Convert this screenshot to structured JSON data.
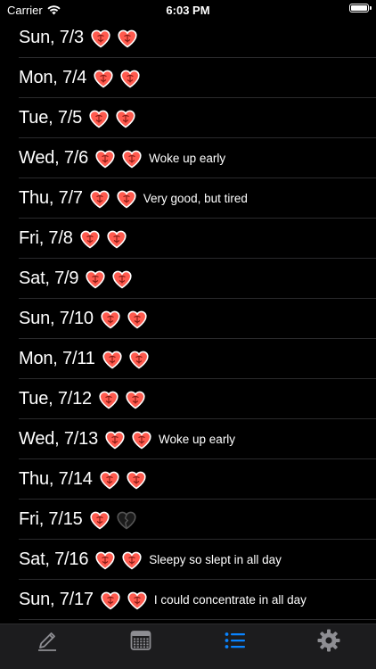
{
  "status": {
    "carrier": "Carrier",
    "time": "6:03 PM"
  },
  "colors": {
    "heart_fill": "#ff5a4e",
    "heart_stroke": "#ffffff",
    "grey_heart": "#555555",
    "tab_active": "#0a84ff",
    "tab_inactive": "#8e8e93"
  },
  "entries": [
    {
      "date": "Sun, 7/3",
      "hearts": [
        "red",
        "red"
      ],
      "note": ""
    },
    {
      "date": "Mon, 7/4",
      "hearts": [
        "red",
        "red"
      ],
      "note": ""
    },
    {
      "date": "Tue, 7/5",
      "hearts": [
        "red",
        "red"
      ],
      "note": ""
    },
    {
      "date": "Wed, 7/6",
      "hearts": [
        "red",
        "red"
      ],
      "note": "Woke up early"
    },
    {
      "date": "Thu, 7/7",
      "hearts": [
        "red",
        "red"
      ],
      "note": "Very good, but tired"
    },
    {
      "date": "Fri, 7/8",
      "hearts": [
        "red",
        "red"
      ],
      "note": ""
    },
    {
      "date": "Sat, 7/9",
      "hearts": [
        "red",
        "red"
      ],
      "note": ""
    },
    {
      "date": "Sun, 7/10",
      "hearts": [
        "red",
        "red"
      ],
      "note": ""
    },
    {
      "date": "Mon, 7/11",
      "hearts": [
        "red",
        "red"
      ],
      "note": ""
    },
    {
      "date": "Tue, 7/12",
      "hearts": [
        "red",
        "red"
      ],
      "note": ""
    },
    {
      "date": "Wed, 7/13",
      "hearts": [
        "red",
        "red"
      ],
      "note": "Woke up early"
    },
    {
      "date": "Thu, 7/14",
      "hearts": [
        "red",
        "red"
      ],
      "note": ""
    },
    {
      "date": "Fri, 7/15",
      "hearts": [
        "red",
        "grey"
      ],
      "note": ""
    },
    {
      "date": "Sat, 7/16",
      "hearts": [
        "red",
        "red"
      ],
      "note": "Sleepy so slept in all day"
    },
    {
      "date": "Sun, 7/17",
      "hearts": [
        "red",
        "red"
      ],
      "note": "I could concentrate in all day"
    }
  ],
  "tabs": [
    {
      "icon": "pencil-icon",
      "active": false
    },
    {
      "icon": "calendar-icon",
      "active": false
    },
    {
      "icon": "list-icon",
      "active": true
    },
    {
      "icon": "gear-icon",
      "active": false
    }
  ]
}
